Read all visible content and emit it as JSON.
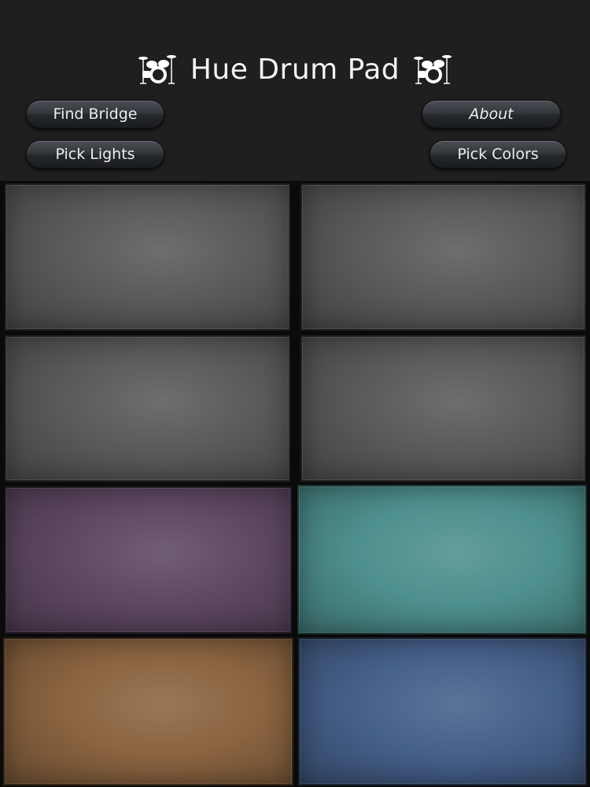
{
  "header": {
    "title": "Hue Drum Pad",
    "left_icon": "drum-kit-icon",
    "right_icon": "drum-kit-icon",
    "background": "#1f1f20"
  },
  "buttons": {
    "find_bridge": "Find Bridge",
    "pick_lights": "Pick Lights",
    "about": "About",
    "pick_colors": "Pick Colors"
  },
  "pads": [
    {
      "name": "pad-1",
      "color": "#5a5a5c"
    },
    {
      "name": "pad-2",
      "color": "#5a5a5c"
    },
    {
      "name": "pad-3",
      "color": "#5a5a5c"
    },
    {
      "name": "pad-4",
      "color": "#5a5a5c"
    },
    {
      "name": "pad-5",
      "color": "#5e4863"
    },
    {
      "name": "pad-6",
      "color": "#4e908f"
    },
    {
      "name": "pad-7",
      "color": "#8b6440"
    },
    {
      "name": "pad-8",
      "color": "#45608a"
    }
  ]
}
